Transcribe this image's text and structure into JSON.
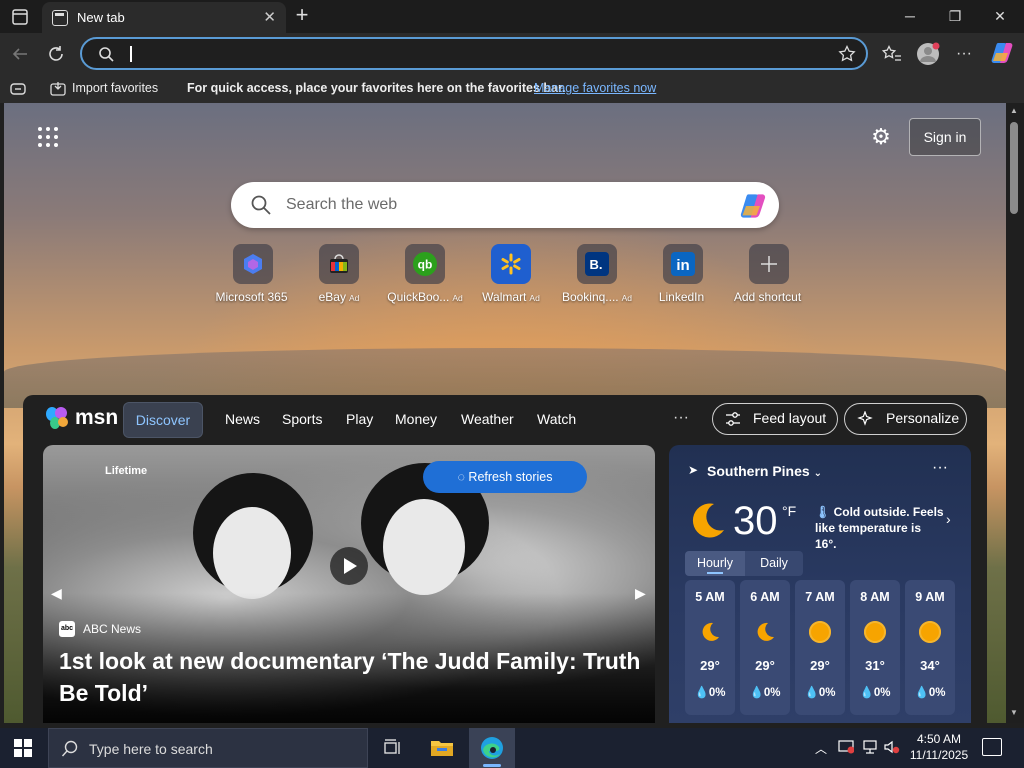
{
  "browser": {
    "tab_title": "New tab",
    "new_tab": "+",
    "window_controls": {
      "minimize": "─",
      "restore": "❐",
      "close": "✕"
    },
    "address_value": ""
  },
  "favorites_bar": {
    "import_label": "Import favorites",
    "message": "For quick access, place your favorites here on the favorites bar.",
    "manage_link": "Manage favorites now"
  },
  "newtab": {
    "signin_label": "Sign in",
    "search_placeholder": "Search the web",
    "shortcuts": [
      {
        "label": "Microsoft 365",
        "ad": "",
        "icon": "m365-icon"
      },
      {
        "label": "eBay",
        "ad": "Ad",
        "icon": "ebay-icon"
      },
      {
        "label": "QuickBoo...",
        "ad": "Ad",
        "icon": "quickbooks-icon"
      },
      {
        "label": "Walmart",
        "ad": "Ad",
        "icon": "walmart-icon"
      },
      {
        "label": "Bookinq....",
        "ad": "Ad",
        "icon": "booking-icon"
      },
      {
        "label": "LinkedIn",
        "ad": "",
        "icon": "linkedin-icon"
      },
      {
        "label": "Add shortcut",
        "ad": "",
        "icon": "plus-icon"
      }
    ]
  },
  "feed": {
    "brand": "msn",
    "tabs": [
      "Discover",
      "News",
      "Sports",
      "Play",
      "Money",
      "Weather",
      "Watch"
    ],
    "more": "···",
    "feed_layout_label": "Feed layout",
    "personalize_label": "Personalize",
    "hero": {
      "channel": "Lifetime",
      "refresh_label": "Refresh stories",
      "source": "ABC News",
      "headline": "1st look at new documentary ‘The Judd Family: Truth Be Told’"
    },
    "weather": {
      "location": "Southern Pines",
      "temp": "30",
      "unit": "°F",
      "summary": "Cold outside. Feels like temperature is 16°.",
      "tab_hourly": "Hourly",
      "tab_daily": "Daily",
      "hours": [
        {
          "time": "5 AM",
          "temp": "29°",
          "precip": "0%",
          "icon": "moon-icon"
        },
        {
          "time": "6 AM",
          "temp": "29°",
          "precip": "0%",
          "icon": "moon-icon"
        },
        {
          "time": "7 AM",
          "temp": "29°",
          "precip": "0%",
          "icon": "sun-icon"
        },
        {
          "time": "8 AM",
          "temp": "31°",
          "precip": "0%",
          "icon": "sun-icon"
        },
        {
          "time": "9 AM",
          "temp": "34°",
          "precip": "0%",
          "icon": "sun-icon"
        }
      ]
    }
  },
  "taskbar": {
    "search_placeholder": "Type here to search",
    "time": "4:50 AM",
    "date": "11/11/2025"
  },
  "colors": {
    "accent": "#1f6fd6",
    "link": "#7ab7ff",
    "weather_bg": "#213052"
  }
}
